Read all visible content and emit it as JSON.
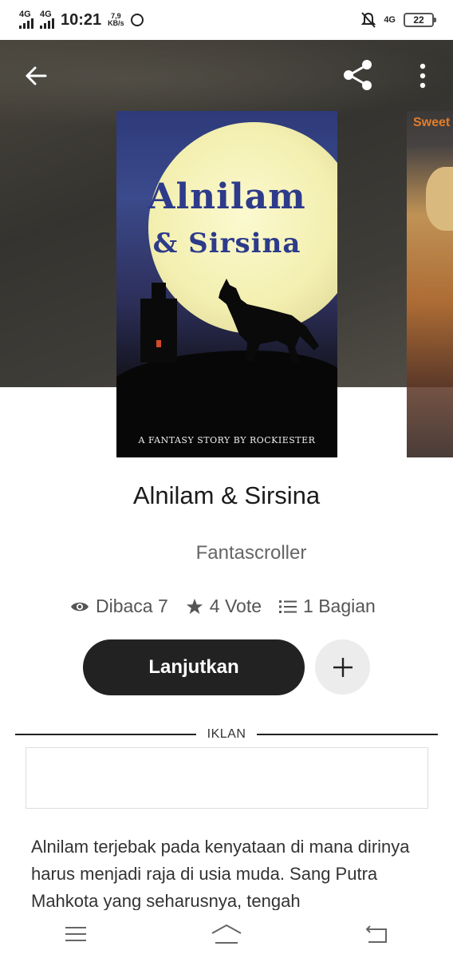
{
  "status_bar": {
    "network_1": "4G",
    "network_2": "4G",
    "time": "10:21",
    "speed_value": "7,9",
    "speed_unit": "KB/s",
    "network_3": "4G",
    "battery": "22"
  },
  "book": {
    "cover_title_line1": "Alnilam",
    "cover_title_line2": "& Sirsina",
    "cover_credit": "A FANTASY STORY BY ROCKIESTER",
    "next_cover_title": "Sweet",
    "title": "Alnilam & Sirsina",
    "author": "Fantascroller",
    "reads": "Dibaca 7",
    "votes": "4 Vote",
    "parts": "1 Bagian"
  },
  "actions": {
    "continue_label": "Lanjutkan"
  },
  "ad": {
    "label": "IKLAN"
  },
  "description": "Alnilam terjebak pada kenyataan di mana dirinya harus menjadi raja di usia muda. Sang Putra Mahkota yang seharusnya, tengah",
  "icons": {
    "back": "arrow-left",
    "share": "share",
    "more": "dots-vertical",
    "reads": "eye",
    "votes": "star",
    "parts": "list",
    "add": "plus",
    "nav_menu": "menu",
    "nav_home": "home",
    "nav_back": "back"
  }
}
